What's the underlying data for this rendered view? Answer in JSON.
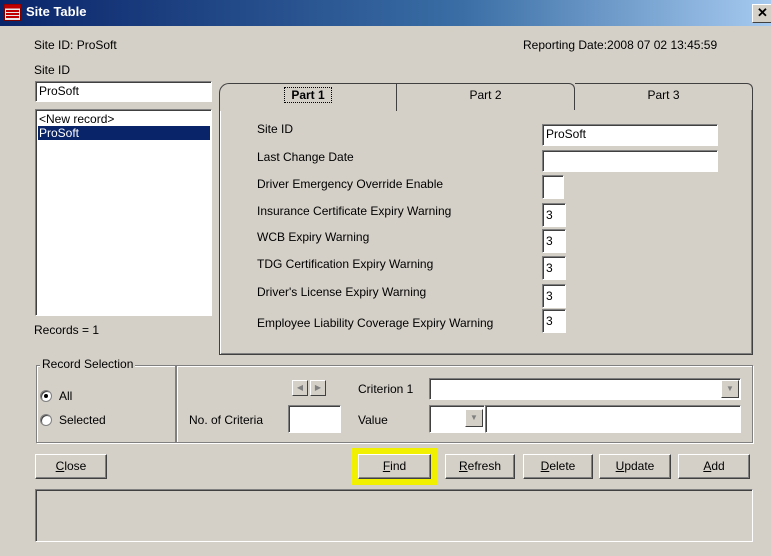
{
  "window": {
    "title": "Site Table",
    "close_glyph": "✕"
  },
  "header": {
    "site_id_caption": "Site ID:",
    "site_id_value": "ProSoft",
    "reporting_date": "Reporting Date:2008 07 02 13:45:59"
  },
  "left_panel": {
    "site_id_label": "Site ID",
    "site_id_input": "ProSoft",
    "records": [
      {
        "label": "<New record>",
        "selected": false
      },
      {
        "label": "ProSoft",
        "selected": true
      }
    ],
    "records_count": "Records = 1"
  },
  "tabs": [
    {
      "label": "Part 1",
      "active": true
    },
    {
      "label": "Part 2",
      "active": false
    },
    {
      "label": "Part 3",
      "active": false
    }
  ],
  "form": {
    "site_id": {
      "label": "Site ID",
      "value": "ProSoft"
    },
    "last_change_date": {
      "label": "Last Change Date",
      "value": ""
    },
    "driver_override": {
      "label": "Driver Emergency Override Enable",
      "value": ""
    },
    "insurance_warning": {
      "label": "Insurance Certificate Expiry Warning",
      "value": "3"
    },
    "wcb_warning": {
      "label": "WCB Expiry Warning",
      "value": "3"
    },
    "tdg_warning": {
      "label": "TDG Certification Expiry Warning",
      "value": "3"
    },
    "license_warning": {
      "label": "Driver's License Expiry Warning",
      "value": "3"
    },
    "liability_warning": {
      "label": "Employee Liability Coverage Expiry Warning",
      "value": "3"
    }
  },
  "record_selection": {
    "legend": "Record Selection",
    "options": [
      {
        "label": "All",
        "checked": true
      },
      {
        "label": "Selected",
        "checked": false
      }
    ]
  },
  "criteria": {
    "no_of_criteria_label": "No. of Criteria",
    "no_of_criteria_value": "",
    "criterion_label": "Criterion 1",
    "criterion_value": "",
    "value_label": "Value",
    "value_value": ""
  },
  "buttons": {
    "close": {
      "mnemonic": "C",
      "rest": "lose"
    },
    "find": {
      "mnemonic": "F",
      "rest": "ind"
    },
    "refresh": {
      "mnemonic": "R",
      "rest": "efresh"
    },
    "delete": {
      "mnemonic": "D",
      "rest": "elete"
    },
    "update": {
      "mnemonic": "U",
      "rest": "pdate"
    },
    "add": {
      "mnemonic": "A",
      "rest": "dd"
    }
  },
  "colors": {
    "title_bar": "#0a246a",
    "selection": "#0a246a",
    "highlight": "#f0f000",
    "face": "#d4d0c8"
  },
  "icons": {
    "app": "table-app-icon",
    "close": "close-icon",
    "prev": "left-arrow-icon",
    "next": "right-arrow-icon",
    "dropdown": "dropdown-arrow-icon"
  }
}
